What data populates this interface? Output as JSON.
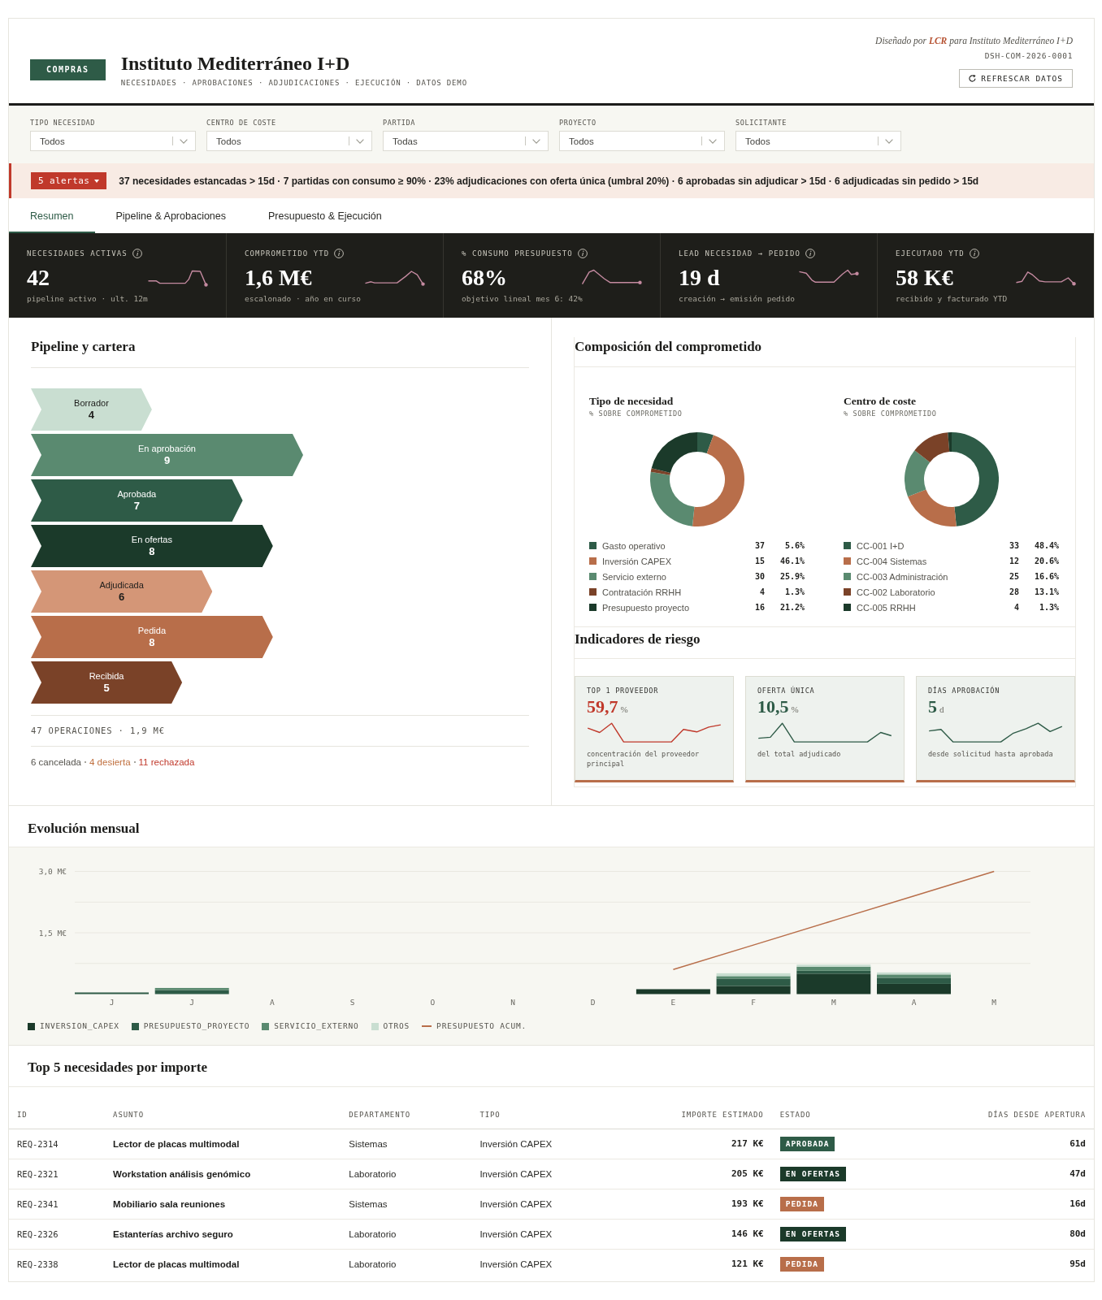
{
  "header": {
    "badge": "COMPRAS",
    "title": "Instituto Mediterráneo I+D",
    "subtitle": "NECESIDADES · APROBACIONES · ADJUDICACIONES · EJECUCIÓN · DATOS DEMO",
    "credit": "Diseñado por **LCR** para Instituto Mediterráneo I+D",
    "code": "DSH-COM-2026-0001",
    "refresh_button": "REFRESCAR DATOS"
  },
  "filters": [
    {
      "label": "TIPO NECESIDAD",
      "value": "Todos"
    },
    {
      "label": "CENTRO DE COSTE",
      "value": "Todos"
    },
    {
      "label": "PARTIDA",
      "value": "Todas"
    },
    {
      "label": "PROYECTO",
      "value": "Todos"
    },
    {
      "label": "SOLICITANTE",
      "value": "Todos"
    }
  ],
  "alerts": {
    "badge": "5 alertas",
    "text": "37 necesidades estancadas > 15d · 7 partidas con consumo ≥ 90% · 23% adjudicaciones con oferta única (umbral 20%) · 6 aprobadas sin adjudicar > 15d · 6 adjudicadas sin pedido > 15d"
  },
  "tabs": [
    {
      "label": "Resumen",
      "selected": true
    },
    {
      "label": "Pipeline & Aprobaciones",
      "selected": false
    },
    {
      "label": "Presupuesto & Ejecución",
      "selected": false
    }
  ],
  "kpis": [
    {
      "label": "NECESIDADES ACTIVAS",
      "value": "42",
      "caption": "pipeline activo · ult. 12m"
    },
    {
      "label": "COMPROMETIDO YTD",
      "value": "1,6 M€",
      "caption": "escalonado · año en curso"
    },
    {
      "label": "% CONSUMO PRESUPUESTO",
      "value": "68%",
      "caption": "objetivo lineal mes 6: 42%"
    },
    {
      "label": "LEAD NECESIDAD → PEDIDO",
      "value": "19 d",
      "caption": "creación → emisión pedido"
    },
    {
      "label": "EJECUTADO YTD",
      "value": "58 K€",
      "caption": "recibido y facturado YTD"
    }
  ],
  "pipeline": {
    "title": "Pipeline y cartera",
    "stages": [
      {
        "label": "Borrador",
        "count": "4",
        "color": "#c9ded1"
      },
      {
        "label": "En aprobación",
        "count": "9",
        "color": "#5a8a70"
      },
      {
        "label": "Aprobada",
        "count": "7",
        "color": "#2e5b47"
      },
      {
        "label": "En ofertas",
        "count": "8",
        "color": "#1b3a2a"
      },
      {
        "label": "Adjudicada",
        "count": "6",
        "color": "#d49677"
      },
      {
        "label": "Pedida",
        "count": "8",
        "color": "#b86e4a"
      },
      {
        "label": "Recibida",
        "count": "5",
        "color": "#7a4228"
      }
    ],
    "summary": "47 OPERACIONES · 1,9 M€",
    "closed": [
      {
        "label": "6 cancelada",
        "color": "#55534d"
      },
      {
        "label": "4 desierta",
        "color": "#c0703f"
      },
      {
        "label": "11 rechazada",
        "color": "#c0392b"
      }
    ]
  },
  "composition": {
    "title": "Composición del comprometido",
    "charts": [
      {
        "title": "Tipo de necesidad",
        "subtitle": "% SOBRE COMPROMETIDO",
        "chart_data": {
          "type": "donut",
          "categories": [
            "Gasto operativo",
            "Inversión CAPEX",
            "Servicio externo",
            "Contratación RRHH",
            "Presupuesto proyecto"
          ],
          "values": [
            5.6,
            46.1,
            25.9,
            1.3,
            21.2
          ]
        },
        "legend": [
          {
            "count": "37",
            "share": "5.6%",
            "color": "#2e5b47"
          },
          {
            "count": "15",
            "share": "46.1%",
            "color": "#b86e4a"
          },
          {
            "count": "30",
            "share": "25.9%",
            "color": "#5a8a70"
          },
          {
            "count": "4",
            "share": "1.3%",
            "color": "#7a4228"
          },
          {
            "count": "16",
            "share": "21.2%",
            "color": "#1b3a2a"
          }
        ]
      },
      {
        "title": "Centro de coste",
        "subtitle": "% SOBRE COMPROMETIDO",
        "chart_data": {
          "type": "donut",
          "categories": [
            "CC-001 I+D",
            "CC-004 Sistemas",
            "CC-003 Administración",
            "CC-002 Laboratorio",
            "CC-005 RRHH"
          ],
          "values": [
            48.4,
            20.6,
            16.6,
            13.1,
            1.3
          ]
        },
        "legend": [
          {
            "count": "33",
            "share": "48.4%",
            "color": "#2e5b47"
          },
          {
            "count": "12",
            "share": "20.6%",
            "color": "#b86e4a"
          },
          {
            "count": "25",
            "share": "16.6%",
            "color": "#5a8a70"
          },
          {
            "count": "28",
            "share": "13.1%",
            "color": "#7a4228"
          },
          {
            "count": "4",
            "share": "1.3%",
            "color": "#1b3a2a"
          }
        ]
      }
    ]
  },
  "risk": {
    "title": "Indicadores de riesgo",
    "cards": [
      {
        "label": "TOP 1 PROVEEDOR",
        "value": "59,7",
        "unit": "%",
        "caption": "concentración del proveedor principal",
        "color": "#c0392b"
      },
      {
        "label": "OFERTA ÚNICA",
        "value": "10,5",
        "unit": "%",
        "caption": "del total adjudicado",
        "color": "#2e5b47"
      },
      {
        "label": "DÍAS APROBACIÓN",
        "value": "5",
        "unit": "d",
        "caption": "desde solicitud hasta aprobada",
        "color": "#2e5b47"
      }
    ]
  },
  "monthly": {
    "title": "Evolución mensual",
    "chart_data": {
      "type": "bar",
      "stacked": true,
      "categories": [
        "J",
        "J",
        "A",
        "S",
        "O",
        "N",
        "D",
        "E",
        "F",
        "M",
        "A",
        "M"
      ],
      "ylim": [
        0,
        3
      ],
      "yticks": [
        {
          "value": 1.5,
          "label": "1,5 M€"
        },
        {
          "value": 3,
          "label": "3,0 M€"
        }
      ],
      "series": [
        {
          "name": "INVERSION_CAPEX",
          "color": "#1b3a2a",
          "values": [
            0,
            0,
            0,
            0,
            0,
            0,
            0,
            0.12,
            0.2,
            0.5,
            0.25,
            0
          ]
        },
        {
          "name": "PRESUPUESTO_PROYECTO",
          "color": "#2e5b47",
          "values": [
            0.04,
            0.1,
            0,
            0,
            0,
            0,
            0,
            0,
            0.18,
            0.07,
            0.15,
            0
          ]
        },
        {
          "name": "SERVICIO_EXTERNO",
          "color": "#5a8a70",
          "values": [
            0,
            0.05,
            0,
            0,
            0,
            0,
            0,
            0,
            0.06,
            0.1,
            0.08,
            0
          ]
        },
        {
          "name": "OTROS",
          "color": "#c9ded1",
          "values": [
            0,
            0,
            0,
            0,
            0,
            0,
            0,
            0,
            0.07,
            0.05,
            0.05,
            0
          ]
        },
        {
          "name": "PRESUPUESTO ACUM.",
          "type": "line",
          "color": "#b86e4a",
          "values": [
            null,
            null,
            null,
            null,
            null,
            null,
            null,
            0.6,
            1.2,
            1.8,
            2.4,
            3.0
          ]
        }
      ]
    }
  },
  "top_needs": {
    "title": "Top 5 necesidades por importe",
    "columns": [
      "ID",
      "ASUNTO",
      "DEPARTAMENTO",
      "TIPO",
      "IMPORTE ESTIMADO",
      "ESTADO",
      "DÍAS DESDE APERTURA"
    ],
    "rows": [
      {
        "id": "REQ-2314",
        "subject": "Lector de placas multimodal",
        "department": "Sistemas",
        "type": "Inversión CAPEX",
        "amount": "217 K€",
        "status": {
          "label": "APROBADA",
          "color": "#2e5b47"
        },
        "days": "61d"
      },
      {
        "id": "REQ-2321",
        "subject": "Workstation análisis genómico",
        "department": "Laboratorio",
        "type": "Inversión CAPEX",
        "amount": "205 K€",
        "status": {
          "label": "EN OFERTAS",
          "color": "#1b3a2a"
        },
        "days": "47d"
      },
      {
        "id": "REQ-2341",
        "subject": "Mobiliario sala reuniones",
        "department": "Sistemas",
        "type": "Inversión CAPEX",
        "amount": "193 K€",
        "status": {
          "label": "PEDIDA",
          "color": "#b86e4a"
        },
        "days": "16d"
      },
      {
        "id": "REQ-2326",
        "subject": "Estanterías archivo seguro",
        "department": "Laboratorio",
        "type": "Inversión CAPEX",
        "amount": "146 K€",
        "status": {
          "label": "EN OFERTAS",
          "color": "#1b3a2a"
        },
        "days": "80d"
      },
      {
        "id": "REQ-2338",
        "subject": "Lector de placas multimodal",
        "department": "Laboratorio",
        "type": "Inversión CAPEX",
        "amount": "121 K€",
        "status": {
          "label": "PEDIDA",
          "color": "#b86e4a"
        },
        "days": "95d"
      }
    ]
  }
}
